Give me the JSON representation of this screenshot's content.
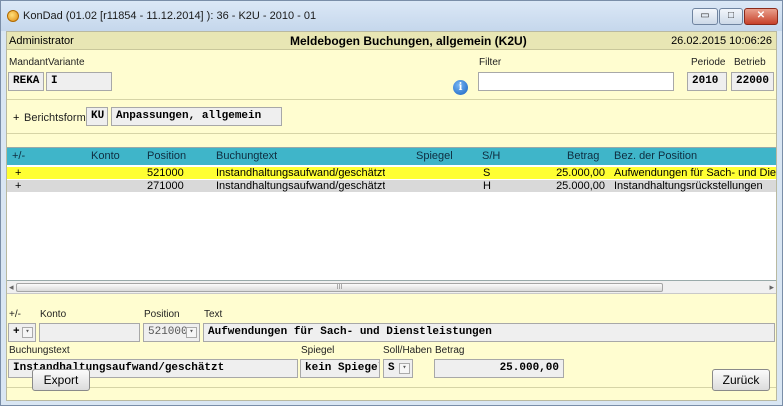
{
  "window": {
    "title": "KonDad (01.02 [r11854 - 11.12.2014] ): 36 - K2U - 2010 - 01",
    "minimize": "▭",
    "maximize": "□",
    "close": "✕"
  },
  "header": {
    "user": "Administrator",
    "title": "Meldebogen Buchungen, allgemein (K2U)",
    "datetime": "26.02.2015 10:06:26"
  },
  "selection": {
    "mandant_label": "Mandant",
    "variante_label": "Variante",
    "mandant_value": "REKA",
    "variante_value": "I",
    "filter_label": "Filter",
    "filter_value": "",
    "periode_label": "Periode",
    "periode_value": "2010",
    "betrieb_label": "Betrieb",
    "betrieb_value": "22000"
  },
  "berichtsform": {
    "toggle": "+",
    "label": "Berichtsform",
    "code": "KU",
    "name": "Anpassungen, allgemein"
  },
  "table": {
    "columns": [
      "+/-",
      "Konto",
      "Position",
      "Buchungtext",
      "Spiegel",
      "S/H",
      "Betrag",
      "Bez. der Position"
    ],
    "rows": [
      [
        "+",
        "",
        "521000",
        "Instandhaltungsaufwand/geschätzt",
        "",
        "S",
        "25.000,00",
        "Aufwendungen für Sach- und Die"
      ],
      [
        "+",
        "",
        "271000",
        "Instandhaltungsaufwand/geschätzt",
        "",
        "H",
        "25.000,00",
        "Instandhaltungsrückstellungen"
      ]
    ]
  },
  "scrollbar": {
    "left_arrow": "◂",
    "right_arrow": "▸",
    "grip": "III"
  },
  "detail": {
    "pm_label": "+/-",
    "konto_label": "Konto",
    "position_label": "Position",
    "text_label": "Text",
    "pm_value": "+",
    "konto_value": "",
    "position_value": "521000",
    "text_value": "Aufwendungen für Sach- und Dienstleistungen",
    "buchungstext_label": "Buchungstext",
    "spiegel_label": "Spiegel",
    "sollhaben_label": "Soll/Haben",
    "betrag_label": "Betrag",
    "buchungstext_value": "Instandhaltungsaufwand/geschätzt",
    "spiegel_value": "kein Spiegel",
    "sollhaben_value": "S",
    "betrag_value": "25.000,00",
    "dropdown_glyph": "▾"
  },
  "buttons": {
    "export": "Export",
    "back": "Zurück"
  },
  "colors": {
    "panel": "#fffdd0",
    "grid_header": "#3fb5c9",
    "selected_row": "#ffff33"
  },
  "icons": [
    "app-icon",
    "info-icon",
    "dropdown-arrow-icon"
  ]
}
